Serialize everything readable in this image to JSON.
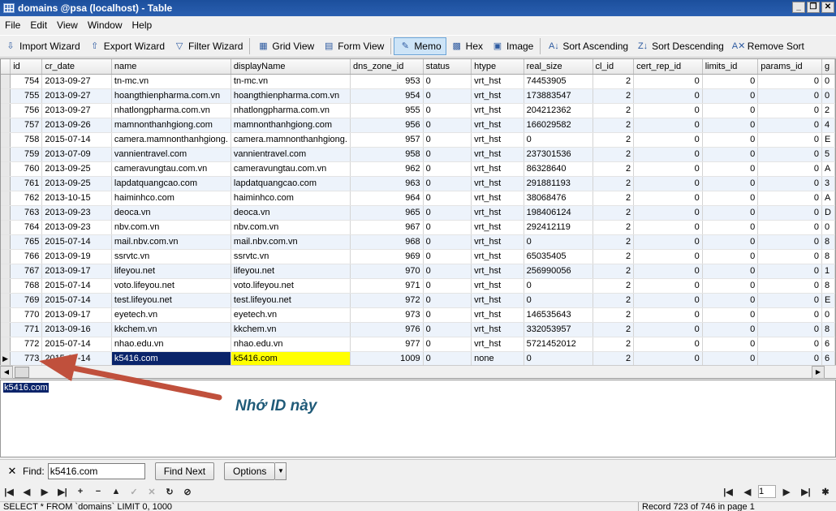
{
  "window": {
    "title": "domains @psa (localhost) - Table"
  },
  "menu": [
    "File",
    "Edit",
    "View",
    "Window",
    "Help"
  ],
  "toolbar": {
    "import": "Import Wizard",
    "export": "Export Wizard",
    "filter": "Filter Wizard",
    "grid_view": "Grid View",
    "form_view": "Form View",
    "memo": "Memo",
    "hex": "Hex",
    "image": "Image",
    "sort_asc": "Sort Ascending",
    "sort_desc": "Sort Descending",
    "remove_sort": "Remove Sort"
  },
  "table": {
    "columns": [
      "id",
      "cr_date",
      "name",
      "displayName",
      "dns_zone_id",
      "status",
      "htype",
      "real_size",
      "cl_id",
      "cert_rep_id",
      "limits_id",
      "params_id",
      "g"
    ],
    "rows": [
      [
        "754",
        "2013-09-27",
        "tn-mc.vn",
        "tn-mc.vn",
        "953",
        "0",
        "vrt_hst",
        "74453905",
        "2",
        "0",
        "0",
        "0",
        "0"
      ],
      [
        "755",
        "2013-09-27",
        "hoangthienpharma.com.vn",
        "hoangthienpharma.com.vn",
        "954",
        "0",
        "vrt_hst",
        "173883547",
        "2",
        "0",
        "0",
        "0",
        "0"
      ],
      [
        "756",
        "2013-09-27",
        "nhatlongpharma.com.vn",
        "nhatlongpharma.com.vn",
        "955",
        "0",
        "vrt_hst",
        "204212362",
        "2",
        "0",
        "0",
        "0",
        "2"
      ],
      [
        "757",
        "2013-09-26",
        "mamnonthanhgiong.com",
        "mamnonthanhgiong.com",
        "956",
        "0",
        "vrt_hst",
        "166029582",
        "2",
        "0",
        "0",
        "0",
        "4"
      ],
      [
        "758",
        "2015-07-14",
        "camera.mamnonthanhgiong.",
        "camera.mamnonthanhgiong.",
        "957",
        "0",
        "vrt_hst",
        "0",
        "2",
        "0",
        "0",
        "0",
        "E"
      ],
      [
        "759",
        "2013-07-09",
        "vannientravel.com",
        "vannientravel.com",
        "958",
        "0",
        "vrt_hst",
        "237301536",
        "2",
        "0",
        "0",
        "0",
        "5"
      ],
      [
        "760",
        "2013-09-25",
        "cameravungtau.com.vn",
        "cameravungtau.com.vn",
        "962",
        "0",
        "vrt_hst",
        "86328640",
        "2",
        "0",
        "0",
        "0",
        "A"
      ],
      [
        "761",
        "2013-09-25",
        "lapdatquangcao.com",
        "lapdatquangcao.com",
        "963",
        "0",
        "vrt_hst",
        "291881193",
        "2",
        "0",
        "0",
        "0",
        "3"
      ],
      [
        "762",
        "2013-10-15",
        "haiminhco.com",
        "haiminhco.com",
        "964",
        "0",
        "vrt_hst",
        "38068476",
        "2",
        "0",
        "0",
        "0",
        "A"
      ],
      [
        "763",
        "2013-09-23",
        "deoca.vn",
        "deoca.vn",
        "965",
        "0",
        "vrt_hst",
        "198406124",
        "2",
        "0",
        "0",
        "0",
        "D"
      ],
      [
        "764",
        "2013-09-23",
        "nbv.com.vn",
        "nbv.com.vn",
        "967",
        "0",
        "vrt_hst",
        "292412119",
        "2",
        "0",
        "0",
        "0",
        "0"
      ],
      [
        "765",
        "2015-07-14",
        "mail.nbv.com.vn",
        "mail.nbv.com.vn",
        "968",
        "0",
        "vrt_hst",
        "0",
        "2",
        "0",
        "0",
        "0",
        "8"
      ],
      [
        "766",
        "2013-09-19",
        "ssrvtc.vn",
        "ssrvtc.vn",
        "969",
        "0",
        "vrt_hst",
        "65035405",
        "2",
        "0",
        "0",
        "0",
        "8"
      ],
      [
        "767",
        "2013-09-17",
        "lifeyou.net",
        "lifeyou.net",
        "970",
        "0",
        "vrt_hst",
        "256990056",
        "2",
        "0",
        "0",
        "0",
        "1"
      ],
      [
        "768",
        "2015-07-14",
        "voto.lifeyou.net",
        "voto.lifeyou.net",
        "971",
        "0",
        "vrt_hst",
        "0",
        "2",
        "0",
        "0",
        "0",
        "8"
      ],
      [
        "769",
        "2015-07-14",
        "test.lifeyou.net",
        "test.lifeyou.net",
        "972",
        "0",
        "vrt_hst",
        "0",
        "2",
        "0",
        "0",
        "0",
        "E"
      ],
      [
        "770",
        "2013-09-17",
        "eyetech.vn",
        "eyetech.vn",
        "973",
        "0",
        "vrt_hst",
        "146535643",
        "2",
        "0",
        "0",
        "0",
        "0"
      ],
      [
        "771",
        "2013-09-16",
        "kkchem.vn",
        "kkchem.vn",
        "976",
        "0",
        "vrt_hst",
        "332053957",
        "2",
        "0",
        "0",
        "0",
        "8"
      ],
      [
        "772",
        "2015-07-14",
        "nhao.edu.vn",
        "nhao.edu.vn",
        "977",
        "0",
        "vrt_hst",
        "5721452012",
        "2",
        "0",
        "0",
        "0",
        "6"
      ],
      [
        "773",
        "2015-07-14",
        "k5416.com",
        "k5416.com",
        "1009",
        "0",
        "none",
        "0",
        "2",
        "0",
        "0",
        "0",
        "6"
      ]
    ],
    "current_row_index": 19
  },
  "memo": {
    "text": "k5416.com"
  },
  "annotation": {
    "text": "Nhớ ID này",
    "color": "#c0503c"
  },
  "find": {
    "label": "Find:",
    "value": "k5416.com",
    "find_next": "Find Next",
    "options": "Options"
  },
  "nav": {
    "page": "1"
  },
  "status": {
    "sql": "SELECT * FROM `domains` LIMIT 0, 1000",
    "record": "Record 723 of 746 in page 1"
  }
}
